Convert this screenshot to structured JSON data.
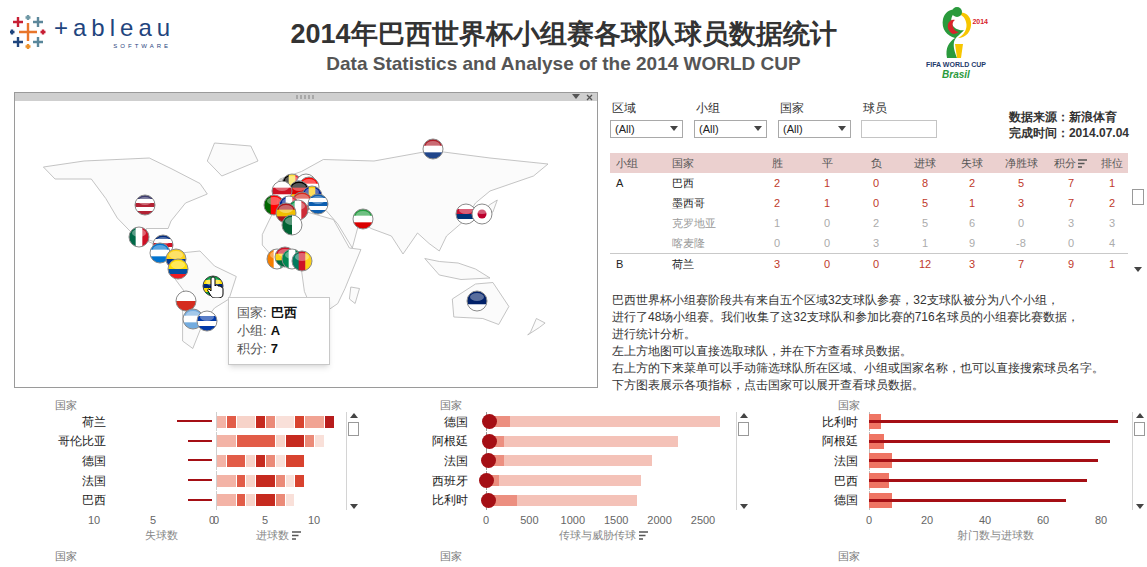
{
  "header": {
    "logo": {
      "wordmark": "+ableau",
      "tagline": "SOFTWARE"
    },
    "title": "2014年巴西世界杯小组赛各球队球员数据统计",
    "subtitle": "Data Statistics and Analyse of the 2014 WORLD CUP",
    "emblem": {
      "year": "2014",
      "line1": "FIFA WORLD CUP",
      "line2": "Brasil"
    }
  },
  "map": {
    "flags": [
      {
        "colors": [
          "#ae1c28",
          "#ffffff",
          "#21468b"
        ],
        "kind": "h",
        "lon": 100.7,
        "lat": 78,
        "hovered": false
      },
      {
        "colors": [
          "#3c3b6e",
          "#ffffff",
          "#b22234",
          "#ffffff",
          "#b22234"
        ],
        "kind": "h",
        "lon": -98,
        "lat": 40.7,
        "hovered": false
      },
      {
        "colors": [
          "#006847",
          "#ffffff",
          "#ce1126"
        ],
        "kind": "v",
        "lon": -102,
        "lat": 19.3,
        "hovered": false
      },
      {
        "colors": [
          "#002b7f",
          "#ffffff",
          "#ce1126",
          "#ffffff",
          "#002b7f"
        ],
        "kind": "h",
        "lon": -85.5,
        "lat": 14,
        "hovered": false
      },
      {
        "colors": [
          "#0073cf",
          "#ffffff",
          "#0073cf"
        ],
        "kind": "h",
        "lon": -87.6,
        "lat": 8.7,
        "hovered": false
      },
      {
        "colors": [
          "#fcd116",
          "#fcd116",
          "#003893",
          "#ce1126"
        ],
        "kind": "h",
        "lon": -76.6,
        "lat": 4.7,
        "hovered": false
      },
      {
        "colors": [
          "#ffdd00",
          "#ffdd00",
          "#034ea2",
          "#ed1c24"
        ],
        "kind": "h",
        "lon": -75.2,
        "lat": -2,
        "hovered": false
      },
      {
        "colors": [
          "#ffffff",
          "#d52b1e"
        ],
        "kind": "h",
        "lon": -69.7,
        "lat": -23.3,
        "hovered": false
      },
      {
        "colors": [
          "#74acdf",
          "#ffffff",
          "#74acdf"
        ],
        "kind": "h",
        "lon": -64.8,
        "lat": -35.3,
        "hovered": false
      },
      {
        "colors": [
          "#ffffff",
          "#0038a8",
          "#ffffff",
          "#0038a8"
        ],
        "kind": "h",
        "lon": -55.2,
        "lat": -36.7,
        "hovered": false
      },
      {
        "colors": [
          "#000000",
          "#fae042",
          "#ed2939"
        ],
        "kind": "v",
        "lon": 3.4,
        "lat": 54.7,
        "hovered": false
      },
      {
        "colors": [
          "#ffffff",
          "#0039a6",
          "#d52b1e"
        ],
        "kind": "h",
        "lon": 13.1,
        "lat": 54.7,
        "hovered": false
      },
      {
        "colors": [
          "#ff0000",
          "#ffffff",
          "#171796"
        ],
        "kind": "h",
        "lon": 15.2,
        "lat": 52.7,
        "hovered": false
      },
      {
        "colors": [
          "#000000",
          "#dd0000",
          "#ffce00"
        ],
        "kind": "h",
        "lon": 8.3,
        "lat": 50,
        "hovered": false
      },
      {
        "colors": [
          "#ffffff",
          "#ce1124",
          "#ffffff"
        ],
        "kind": "h",
        "lon": -3.4,
        "lat": 50,
        "hovered": false
      },
      {
        "colors": [
          "#002395",
          "#fecb00",
          "#002395"
        ],
        "kind": "v",
        "lon": 17.2,
        "lat": 46.7,
        "hovered": false
      },
      {
        "colors": [
          "#d52b1e",
          "#ffffff",
          "#d52b1e"
        ],
        "kind": "h",
        "lon": 10.3,
        "lat": 42.7,
        "hovered": false
      },
      {
        "colors": [
          "#0d5eaf",
          "#ffffff",
          "#0d5eaf",
          "#ffffff",
          "#0d5eaf"
        ],
        "kind": "h",
        "lon": 21.4,
        "lat": 41.3,
        "hovered": false
      },
      {
        "colors": [
          "#006600",
          "#ff0000",
          "#ff0000"
        ],
        "kind": "v",
        "lon": -9,
        "lat": 40.7,
        "hovered": false
      },
      {
        "colors": [
          "#002395",
          "#ffffff",
          "#ed2939"
        ],
        "kind": "v",
        "lon": 1.4,
        "lat": 40,
        "hovered": false
      },
      {
        "colors": [
          "#009246",
          "#ffffff",
          "#ce2b37"
        ],
        "kind": "v",
        "lon": 7.6,
        "lat": 37.3,
        "hovered": false
      },
      {
        "colors": [
          "#aa151b",
          "#f1bf00",
          "#aa151b"
        ],
        "kind": "h",
        "lon": -0.7,
        "lat": 35.3,
        "hovered": false
      },
      {
        "colors": [
          "#006233",
          "#ffffff"
        ],
        "kind": "v",
        "lon": 3.4,
        "lat": 27.3,
        "hovered": false
      },
      {
        "colors": [
          "#239f40",
          "#ffffff",
          "#da0000"
        ],
        "kind": "h",
        "lon": 52.4,
        "lat": 31.3,
        "hovered": false
      },
      {
        "colors": [
          "#ffffff",
          "#c60c30",
          "#003478",
          "#ffffff"
        ],
        "kind": "h",
        "lon": 123.4,
        "lat": 34.7,
        "hovered": false
      },
      {
        "colors": [
          "#ffffff",
          "#bc002d"
        ],
        "kind": "dot",
        "lon": 134.5,
        "lat": 34.7,
        "hovered": false
      },
      {
        "colors": [
          "#f77f00",
          "#ffffff",
          "#009e60"
        ],
        "kind": "v",
        "lon": -6.9,
        "lat": 4.7,
        "hovered": false
      },
      {
        "colors": [
          "#ce1126",
          "#fcd116",
          "#006b3f"
        ],
        "kind": "h",
        "lon": -1.4,
        "lat": 6,
        "hovered": false
      },
      {
        "colors": [
          "#008751",
          "#ffffff",
          "#008751"
        ],
        "kind": "v",
        "lon": 3.4,
        "lat": 4.7,
        "hovered": false
      },
      {
        "colors": [
          "#007a5e",
          "#ce1126",
          "#fcd116"
        ],
        "kind": "v",
        "lon": 10.3,
        "lat": 3.3,
        "hovered": false
      },
      {
        "colors": [
          "#012169",
          "#012169",
          "#ffffff"
        ],
        "kind": "h",
        "lon": 131,
        "lat": -23.3,
        "hovered": false
      },
      {
        "colors": [
          "#009c3b",
          "#ffdf00",
          "#002776",
          "#ffdf00",
          "#009c3b"
        ],
        "kind": "h",
        "lon": -51,
        "lat": -13.3,
        "hovered": true
      }
    ],
    "tooltip": {
      "rows": [
        {
          "label": "国家:",
          "value": "巴西"
        },
        {
          "label": "小组:",
          "value": "A"
        },
        {
          "label": "积分:",
          "value": "7"
        }
      ]
    }
  },
  "filters": [
    {
      "label": "区域",
      "value": "(All)",
      "kind": "dropdown"
    },
    {
      "label": "小组",
      "value": "(All)",
      "kind": "dropdown"
    },
    {
      "label": "国家",
      "value": "(All)",
      "kind": "dropdown"
    },
    {
      "label": "球员",
      "value": "",
      "kind": "search"
    }
  ],
  "source": [
    "数据来源：新浪体育",
    "完成时间：2014.07.04"
  ],
  "table": {
    "columns": [
      "小组",
      "国家",
      "胜",
      "平",
      "负",
      "进球",
      "失球",
      "净胜球",
      "积分",
      "排位"
    ],
    "sorted_column": 8,
    "groups": [
      {
        "label": "A",
        "rows": [
          {
            "team": "巴西",
            "stats": [
              "2",
              "1",
              "0",
              "8",
              "2",
              "5",
              "7",
              "1"
            ],
            "qualified": true
          },
          {
            "team": "墨西哥",
            "stats": [
              "2",
              "1",
              "0",
              "5",
              "1",
              "3",
              "7",
              "2"
            ],
            "qualified": true
          },
          {
            "team": "克罗地亚",
            "stats": [
              "1",
              "0",
              "2",
              "5",
              "6",
              "0",
              "3",
              "3"
            ],
            "qualified": false
          },
          {
            "team": "喀麦隆",
            "stats": [
              "0",
              "0",
              "3",
              "1",
              "9",
              "-8",
              "0",
              "4"
            ],
            "qualified": false
          }
        ]
      },
      {
        "label": "B",
        "rows": [
          {
            "team": "荷兰",
            "stats": [
              "3",
              "0",
              "0",
              "12",
              "3",
              "7",
              "9",
              "1"
            ],
            "qualified": true
          }
        ]
      }
    ]
  },
  "description": [
    "巴西世界杯小组赛阶段共有来自五个区域32支球队参赛，32支球队被分为八个小组，",
    "进行了48场小组赛。我们收集了这32支球队和参加比赛的716名球员的小组赛比赛数据，",
    "进行统计分析。",
    "左上方地图可以直接选取球队，并在下方查看球员数据。",
    "右上方的下来菜单可以手动筛选球队所在区域、小组或国家名称，也可以直接搜索球员名字。",
    "下方图表展示各项指标，点击国家可以展开查看球员数据。"
  ],
  "charts": [
    {
      "kind": "diverging",
      "header": "国家",
      "rows": [
        {
          "team": "荷兰",
          "conceded": 3,
          "goals": [
            1,
            1,
            2,
            1,
            1,
            2,
            1,
            2,
            1
          ]
        },
        {
          "team": "哥伦比亚",
          "conceded": 2,
          "goals": [
            2,
            4,
            1,
            2,
            1,
            1
          ]
        },
        {
          "team": "德国",
          "conceded": 2,
          "goals": [
            1,
            2,
            1,
            1,
            1,
            1,
            2
          ]
        },
        {
          "team": "法国",
          "conceded": 2,
          "goals": [
            2,
            1,
            1,
            2,
            1,
            1,
            1
          ]
        },
        {
          "team": "巴西",
          "conceded": 2,
          "goals": [
            2,
            1,
            1,
            2,
            1,
            1
          ]
        }
      ],
      "axes": [
        {
          "title": "失球数",
          "sorted": false,
          "ticks": [
            {
              "label": "10",
              "value": 10
            },
            {
              "label": "5",
              "value": 5
            },
            {
              "label": "0",
              "value": 0
            }
          ]
        },
        {
          "title": "进球数",
          "sorted": true,
          "ticks": [
            {
              "label": "0",
              "value": 0
            },
            {
              "label": "5",
              "value": 5
            },
            {
              "label": "10",
              "value": 10
            }
          ]
        }
      ]
    },
    {
      "kind": "passes",
      "header": "国家",
      "rows": [
        {
          "team": "德国",
          "threat": 40,
          "passes": [
            60,
            220,
            2420
          ]
        },
        {
          "team": "阿根廷",
          "threat": 35,
          "passes": [
            50,
            160,
            2000
          ]
        },
        {
          "team": "法国",
          "threat": 30,
          "passes": [
            40,
            170,
            1700
          ]
        },
        {
          "team": "西班牙",
          "threat": 5,
          "passes": [
            30,
            120,
            1640
          ]
        },
        {
          "team": "比利时",
          "threat": 30,
          "passes": [
            60,
            300,
            1380
          ]
        }
      ],
      "axes": [
        {
          "title": "传球与威胁传球",
          "sorted": true,
          "ticks": [
            {
              "label": "0",
              "value": 0
            },
            {
              "label": "500",
              "value": 500
            },
            {
              "label": "1000",
              "value": 1000
            },
            {
              "label": "1500",
              "value": 1500
            },
            {
              "label": "2000",
              "value": 2000
            },
            {
              "label": "2500",
              "value": 2500
            }
          ]
        }
      ]
    },
    {
      "kind": "shots",
      "header": "国家",
      "rows": [
        {
          "team": "比利时",
          "shots": 86,
          "goals": 4
        },
        {
          "team": "阿根廷",
          "shots": 83,
          "goals": 5
        },
        {
          "team": "法国",
          "shots": 79,
          "goals": 8
        },
        {
          "team": "巴西",
          "shots": 75,
          "goals": 7
        },
        {
          "team": "德国",
          "shots": 68,
          "goals": 8
        }
      ],
      "axes": [
        {
          "title": "射门数与进球数",
          "sorted": false,
          "ticks": [
            {
              "label": "0",
              "value": 0
            },
            {
              "label": "20",
              "value": 20
            },
            {
              "label": "40",
              "value": 40
            },
            {
              "label": "60",
              "value": 60
            },
            {
              "label": "80",
              "value": 80
            }
          ]
        }
      ]
    }
  ],
  "next_row_headers": [
    "国家",
    "国家",
    "国家"
  ]
}
